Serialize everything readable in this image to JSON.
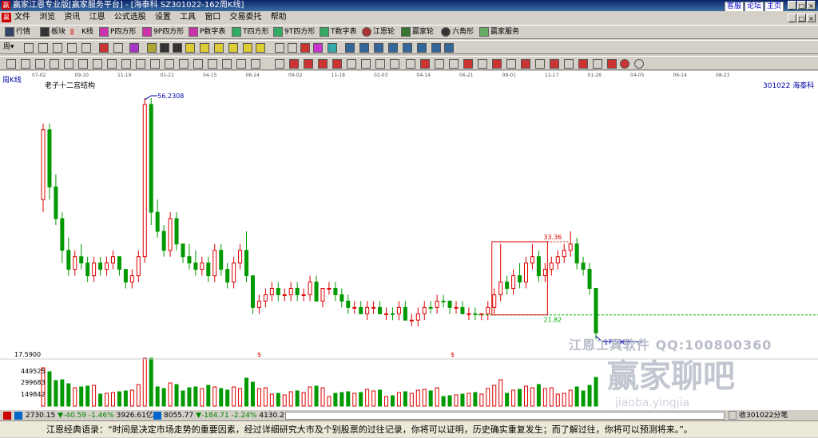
{
  "titlebar": {
    "logo_text": "赢",
    "title": "赢家江恩专业版[赢家服务平台] - [海泰科   SZ301022-162周K线]",
    "links": [
      "客服",
      "论坛",
      "主页"
    ]
  },
  "menubar": {
    "logo_text": "赢",
    "items": [
      "文件",
      "浏览",
      "资讯",
      "江恩",
      "公式选股",
      "设置",
      "工具",
      "窗口",
      "交易委托",
      "帮助"
    ]
  },
  "toolbar1": {
    "items": [
      {
        "label": "行情",
        "icon": "table-icon"
      },
      {
        "label": "板块",
        "icon": "blocks-icon"
      },
      {
        "label": "K线",
        "icon": "kline-icon"
      },
      {
        "label": "P四方形",
        "icon": "p-square-icon"
      },
      {
        "label": "9P四方形",
        "icon": "9p-square-icon"
      },
      {
        "label": "P数字表",
        "icon": "p-table-icon"
      },
      {
        "label": "T四方形",
        "icon": "t-square-icon"
      },
      {
        "label": "9T四方形",
        "icon": "9t-square-icon"
      },
      {
        "label": "T数字表",
        "icon": "t-table-icon"
      },
      {
        "label": "江恩轮",
        "icon": "gann-wheel-icon"
      },
      {
        "label": "赢家轮",
        "icon": "winner-wheel-icon"
      },
      {
        "label": "六角形",
        "icon": "hexagon-icon"
      },
      {
        "label": "赢家服务",
        "icon": "service-icon"
      }
    ]
  },
  "toolbar2": {
    "period_label": "周"
  },
  "chart": {
    "header_left": "周K线",
    "subtitle": "老子十二宫结构",
    "code_name": "301022  海泰科",
    "price_top": "56.2308",
    "price_high_box": "33.36",
    "price_low_box": "21.82",
    "price_low": "17.5900",
    "scale_low": "17.5900",
    "dollar_mark": "$",
    "vol_labels": [
      "449525",
      "299683",
      "149842"
    ],
    "dates": [
      "07-02",
      "09-10",
      "11-19",
      "01-21",
      "04-15",
      "06-24",
      "09-02",
      "11-18",
      "02-03",
      "04-14",
      "06-21",
      "09-01",
      "11-17",
      "01-26",
      "04-05",
      "06-14",
      "08-23"
    ],
    "colors": {
      "up": "#dd0000",
      "down": "#009900",
      "dashed": "#00aa00",
      "box": "#dd0000",
      "annot": "#0000aa"
    }
  },
  "watermark": {
    "line1": "江恩工具软件  QQ:100800360",
    "line2": "赢家聊吧",
    "line3": "jiaoba.yingjia"
  },
  "statusbar": {
    "sh_index": "2730.15",
    "sh_change": "▼-40.59",
    "sh_pct": "-1.46%",
    "sh_amount": "3926.61亿",
    "sz_index": "8055.77",
    "sz_change": "▼-184.71",
    "sz_pct": "-2.24%",
    "sz_amount": "4130.2",
    "right_text": "收301022分笔"
  },
  "bottombar": {
    "quote": "江恩经典语录：“时间是决定市场走势的重要因素，经过详细研究大市及个别股票的过往记录，你将可以证明，历史确实重复发生；而了解过往，你将可以预测将来。”。"
  },
  "chart_data": {
    "type": "candlestick",
    "title": "老子十二宫结构",
    "xlabel": "",
    "ylabel": "",
    "annotations": [
      "56.2308",
      "33.36",
      "21.82",
      "17.5900"
    ],
    "x_ticks": [
      "07-02",
      "09-10",
      "11-19",
      "01-21",
      "04-15",
      "06-24",
      "09-02",
      "11-18",
      "02-03",
      "04-14",
      "06-21",
      "09-01",
      "11-17",
      "01-26",
      "04-05",
      "06-14",
      "08-23"
    ],
    "volume_ticks": [
      449525,
      299683,
      149842
    ],
    "ohlc": [
      [
        40,
        52,
        38,
        51,
        1
      ],
      [
        51,
        52,
        40,
        42,
        0
      ],
      [
        42,
        44,
        36,
        37,
        0
      ],
      [
        37,
        38,
        30,
        32,
        0
      ],
      [
        32,
        34,
        28,
        29,
        0
      ],
      [
        29,
        32,
        28,
        31,
        1
      ],
      [
        31,
        33,
        29,
        30,
        0
      ],
      [
        30,
        31,
        27,
        28,
        0
      ],
      [
        28,
        31,
        27,
        30,
        1
      ],
      [
        30,
        31,
        28,
        29,
        0
      ],
      [
        29,
        31,
        28,
        30,
        1
      ],
      [
        30,
        32,
        29,
        31,
        1
      ],
      [
        31,
        31,
        28,
        29,
        0
      ],
      [
        29,
        29,
        26,
        27,
        0
      ],
      [
        27,
        29,
        26,
        28,
        1
      ],
      [
        28,
        32,
        27,
        31,
        1
      ],
      [
        31,
        56,
        30,
        55,
        1
      ],
      [
        55,
        56,
        36,
        38,
        0
      ],
      [
        38,
        40,
        34,
        35,
        0
      ],
      [
        35,
        36,
        31,
        32,
        0
      ],
      [
        32,
        38,
        31,
        37,
        1
      ],
      [
        37,
        38,
        32,
        33,
        0
      ],
      [
        33,
        33,
        30,
        31,
        0
      ],
      [
        31,
        33,
        29,
        30,
        0
      ],
      [
        30,
        32,
        28,
        29,
        0
      ],
      [
        29,
        31,
        28,
        30,
        1
      ],
      [
        30,
        31,
        27,
        28,
        0
      ],
      [
        28,
        33,
        27,
        32,
        1
      ],
      [
        32,
        33,
        28,
        29,
        0
      ],
      [
        29,
        30,
        26,
        27,
        0
      ],
      [
        27,
        31,
        26,
        30,
        1
      ],
      [
        30,
        33,
        29,
        32,
        1
      ],
      [
        32,
        35,
        27,
        28,
        0
      ],
      [
        28,
        28,
        22,
        23,
        0
      ],
      [
        23,
        25,
        22,
        24,
        1
      ],
      [
        24,
        26,
        23,
        25,
        1
      ],
      [
        25,
        27,
        24,
        26,
        1
      ],
      [
        26,
        27,
        24,
        25,
        0
      ],
      [
        25,
        26,
        24,
        25,
        1
      ],
      [
        25,
        27,
        24,
        26,
        1
      ],
      [
        26,
        27,
        24,
        25,
        0
      ],
      [
        25,
        26,
        24,
        25,
        1
      ],
      [
        25,
        28,
        24,
        27,
        1
      ],
      [
        27,
        28,
        24,
        24,
        0
      ],
      [
        24,
        26,
        23,
        26,
        1
      ],
      [
        26,
        27,
        25,
        26,
        1
      ],
      [
        26,
        27,
        24,
        25,
        0
      ],
      [
        25,
        26,
        23,
        24,
        0
      ],
      [
        24,
        25,
        22,
        23,
        0
      ],
      [
        23,
        24,
        22,
        23,
        1
      ],
      [
        23,
        24,
        22,
        22,
        0
      ],
      [
        22,
        24,
        21,
        23,
        1
      ],
      [
        23,
        24,
        22,
        23,
        1
      ],
      [
        23,
        24,
        22,
        22,
        0
      ],
      [
        22,
        23,
        21,
        22,
        1
      ],
      [
        22,
        23,
        21,
        22,
        0
      ],
      [
        22,
        24,
        21,
        23,
        1
      ],
      [
        23,
        24,
        21,
        21,
        0
      ],
      [
        21,
        22,
        20,
        21,
        1
      ],
      [
        21,
        23,
        20,
        22,
        1
      ],
      [
        22,
        24,
        21,
        23,
        1
      ],
      [
        23,
        24,
        22,
        23,
        0
      ],
      [
        23,
        25,
        22,
        24,
        1
      ],
      [
        24,
        25,
        23,
        24,
        0
      ],
      [
        24,
        24,
        22,
        23,
        0
      ],
      [
        23,
        24,
        22,
        23,
        1
      ],
      [
        23,
        24,
        22,
        22,
        0
      ],
      [
        22,
        23,
        21,
        22,
        1
      ],
      [
        22,
        23,
        21,
        22,
        0
      ],
      [
        22,
        22,
        21,
        22,
        1
      ],
      [
        22,
        24,
        21,
        23,
        1
      ],
      [
        23,
        26,
        22,
        25,
        1
      ],
      [
        25,
        33,
        24,
        27,
        1
      ],
      [
        27,
        28,
        25,
        26,
        0
      ],
      [
        26,
        29,
        25,
        28,
        1
      ],
      [
        28,
        30,
        26,
        27,
        0
      ],
      [
        27,
        31,
        26,
        30,
        1
      ],
      [
        30,
        33,
        29,
        31,
        1
      ],
      [
        31,
        32,
        27,
        28,
        0
      ],
      [
        28,
        30,
        27,
        29,
        1
      ],
      [
        29,
        31,
        28,
        30,
        1
      ],
      [
        30,
        32,
        29,
        31,
        1
      ],
      [
        31,
        33,
        30,
        32,
        1
      ],
      [
        32,
        35,
        31,
        33,
        1
      ],
      [
        33,
        34,
        29,
        30,
        0
      ],
      [
        30,
        31,
        28,
        29,
        0
      ],
      [
        29,
        30,
        25,
        26,
        0
      ],
      [
        26,
        26,
        18,
        19,
        0
      ]
    ]
  }
}
